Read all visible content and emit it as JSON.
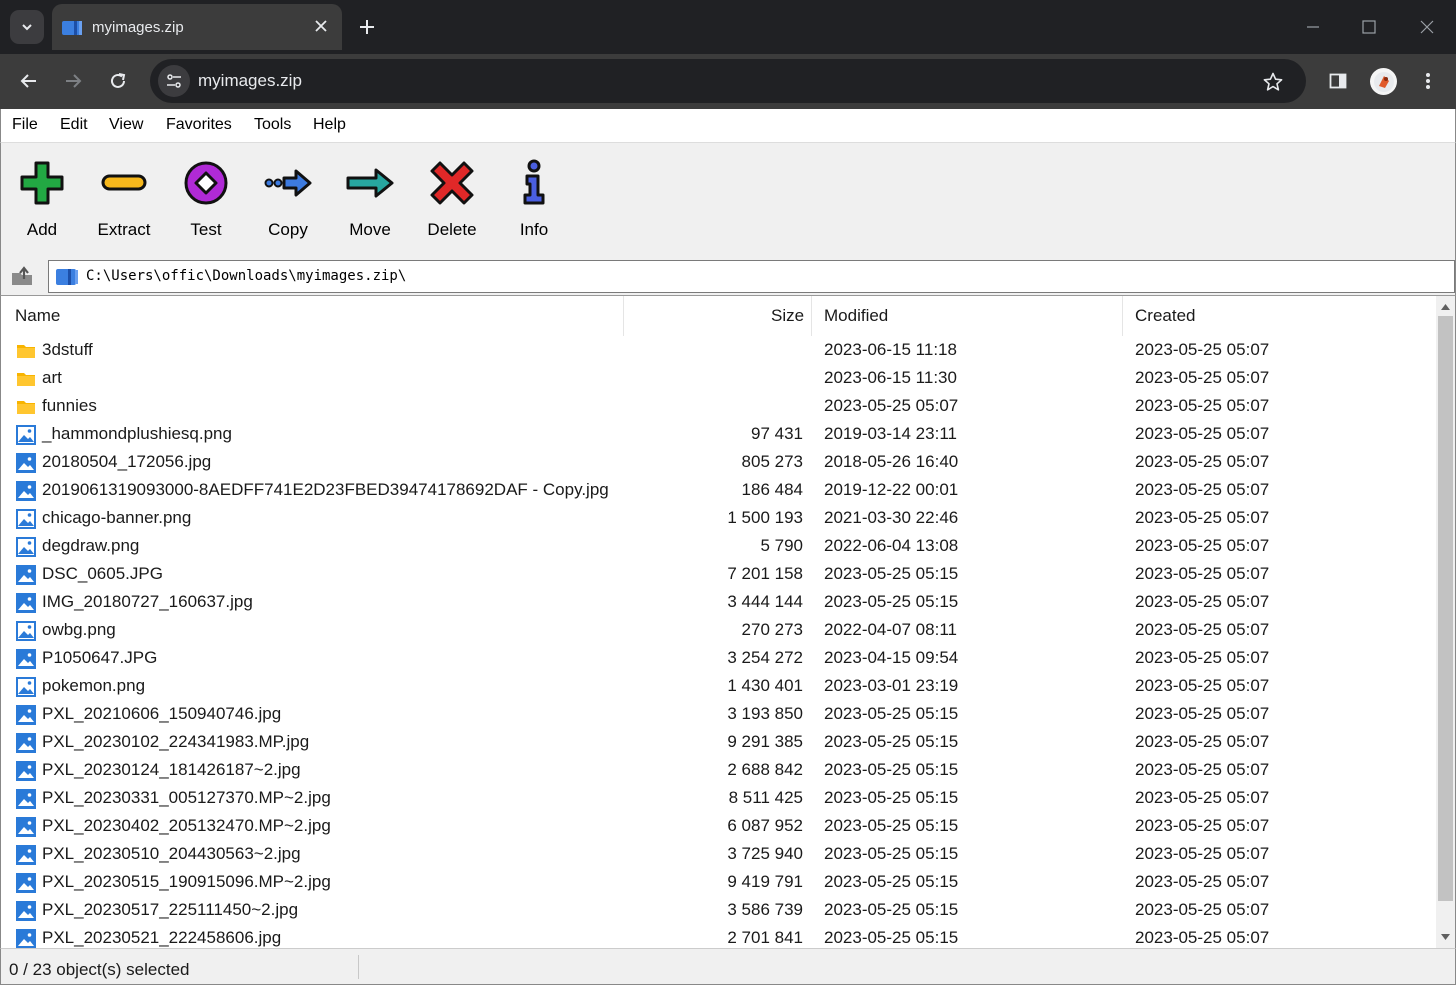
{
  "browser": {
    "tab_title": "myimages.zip",
    "url": "myimages.zip"
  },
  "menu": [
    "File",
    "Edit",
    "View",
    "Favorites",
    "Tools",
    "Help"
  ],
  "actions": [
    {
      "label": "Add",
      "icon": "add-icon",
      "color": "#22a843"
    },
    {
      "label": "Extract",
      "icon": "extract-icon",
      "color": "#f7b81c"
    },
    {
      "label": "Test",
      "icon": "test-icon",
      "color": "#b02ad6"
    },
    {
      "label": "Copy",
      "icon": "copy-icon",
      "color": "#3d7be0"
    },
    {
      "label": "Move",
      "icon": "move-icon",
      "color": "#27a6a0"
    },
    {
      "label": "Delete",
      "icon": "delete-icon",
      "color": "#e02828"
    },
    {
      "label": "Info",
      "icon": "info-icon",
      "color": "#4a5fe0"
    }
  ],
  "address": {
    "path": "C:\\Users\\offic\\Downloads\\myimages.zip\\"
  },
  "columns": {
    "name": "Name",
    "size": "Size",
    "modified": "Modified",
    "created": "Created"
  },
  "files": [
    {
      "type": "folder",
      "name": "3dstuff",
      "size": "",
      "modified": "2023-06-15 11:18",
      "created": "2023-05-25 05:07"
    },
    {
      "type": "folder",
      "name": "art",
      "size": "",
      "modified": "2023-06-15 11:30",
      "created": "2023-05-25 05:07"
    },
    {
      "type": "folder",
      "name": "funnies",
      "size": "",
      "modified": "2023-05-25 05:07",
      "created": "2023-05-25 05:07"
    },
    {
      "type": "png",
      "name": "_hammondplushiesq.png",
      "size": "97 431",
      "modified": "2019-03-14 23:11",
      "created": "2023-05-25 05:07"
    },
    {
      "type": "jpg",
      "name": "20180504_172056.jpg",
      "size": "805 273",
      "modified": "2018-05-26 16:40",
      "created": "2023-05-25 05:07"
    },
    {
      "type": "jpg",
      "name": "2019061319093000-8AEDFF741E2D23FBED39474178692DAF - Copy.jpg",
      "size": "186 484",
      "modified": "2019-12-22 00:01",
      "created": "2023-05-25 05:07"
    },
    {
      "type": "png",
      "name": "chicago-banner.png",
      "size": "1 500 193",
      "modified": "2021-03-30 22:46",
      "created": "2023-05-25 05:07"
    },
    {
      "type": "png",
      "name": "degdraw.png",
      "size": "5 790",
      "modified": "2022-06-04 13:08",
      "created": "2023-05-25 05:07"
    },
    {
      "type": "jpg",
      "name": "DSC_0605.JPG",
      "size": "7 201 158",
      "modified": "2023-05-25 05:15",
      "created": "2023-05-25 05:07"
    },
    {
      "type": "jpg",
      "name": "IMG_20180727_160637.jpg",
      "size": "3 444 144",
      "modified": "2023-05-25 05:15",
      "created": "2023-05-25 05:07"
    },
    {
      "type": "png",
      "name": "owbg.png",
      "size": "270 273",
      "modified": "2022-04-07 08:11",
      "created": "2023-05-25 05:07"
    },
    {
      "type": "jpg",
      "name": "P1050647.JPG",
      "size": "3 254 272",
      "modified": "2023-04-15 09:54",
      "created": "2023-05-25 05:07"
    },
    {
      "type": "png",
      "name": "pokemon.png",
      "size": "1 430 401",
      "modified": "2023-03-01 23:19",
      "created": "2023-05-25 05:07"
    },
    {
      "type": "jpg",
      "name": "PXL_20210606_150940746.jpg",
      "size": "3 193 850",
      "modified": "2023-05-25 05:15",
      "created": "2023-05-25 05:07"
    },
    {
      "type": "jpg",
      "name": "PXL_20230102_224341983.MP.jpg",
      "size": "9 291 385",
      "modified": "2023-05-25 05:15",
      "created": "2023-05-25 05:07"
    },
    {
      "type": "jpg",
      "name": "PXL_20230124_181426187~2.jpg",
      "size": "2 688 842",
      "modified": "2023-05-25 05:15",
      "created": "2023-05-25 05:07"
    },
    {
      "type": "jpg",
      "name": "PXL_20230331_005127370.MP~2.jpg",
      "size": "8 511 425",
      "modified": "2023-05-25 05:15",
      "created": "2023-05-25 05:07"
    },
    {
      "type": "jpg",
      "name": "PXL_20230402_205132470.MP~2.jpg",
      "size": "6 087 952",
      "modified": "2023-05-25 05:15",
      "created": "2023-05-25 05:07"
    },
    {
      "type": "jpg",
      "name": "PXL_20230510_204430563~2.jpg",
      "size": "3 725 940",
      "modified": "2023-05-25 05:15",
      "created": "2023-05-25 05:07"
    },
    {
      "type": "jpg",
      "name": "PXL_20230515_190915096.MP~2.jpg",
      "size": "9 419 791",
      "modified": "2023-05-25 05:15",
      "created": "2023-05-25 05:07"
    },
    {
      "type": "jpg",
      "name": "PXL_20230517_225111450~2.jpg",
      "size": "3 586 739",
      "modified": "2023-05-25 05:15",
      "created": "2023-05-25 05:07"
    },
    {
      "type": "jpg",
      "name": "PXL_20230521_222458606.jpg",
      "size": "2 701 841",
      "modified": "2023-05-25 05:15",
      "created": "2023-05-25 05:07"
    }
  ],
  "status": {
    "selection": "0 / 23 object(s) selected"
  },
  "colors": {
    "folder": "#f8b400",
    "image_icon": "#2a7ad8",
    "chrome_bg": "#202124",
    "chrome_toolbar": "#3c3c3c"
  }
}
